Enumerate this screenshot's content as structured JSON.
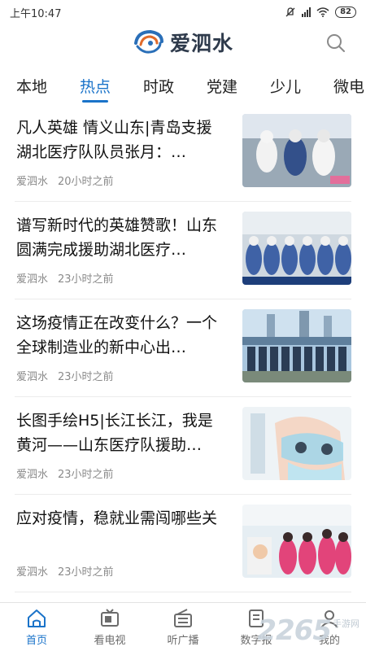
{
  "status_bar": {
    "time": "上午10:47",
    "battery": "82"
  },
  "header": {
    "app_name": "爱泗水"
  },
  "tabs": [
    {
      "label": "本地"
    },
    {
      "label": "热点"
    },
    {
      "label": "时政"
    },
    {
      "label": "党建"
    },
    {
      "label": "少儿"
    },
    {
      "label": "微电"
    }
  ],
  "active_tab": "热点",
  "news": [
    {
      "title": "凡人英雄 情义山东|青岛支援湖北医疗队队员张月：…",
      "source": "爱泗水",
      "time": "20小时之前",
      "thumb": "medical-team-photo"
    },
    {
      "title": "谱写新时代的英雄赞歌！山东圆满完成援助湖北医疗…",
      "source": "爱泗水",
      "time": "23小时之前",
      "thumb": "medics-waving-photo"
    },
    {
      "title": "这场疫情正在改变什么？一个全球制造业的新中心出…",
      "source": "爱泗水",
      "time": "23小时之前",
      "thumb": "group-outdoor-photo"
    },
    {
      "title": "长图手绘H5|长江长江，我是黄河——山东医疗队援助…",
      "source": "爱泗水",
      "time": "23小时之前",
      "thumb": "illustration-nurse-mask"
    },
    {
      "title": "应对疫情，稳就业需闯哪些关",
      "source": "爱泗水",
      "time": "23小时之前",
      "thumb": "workers-pink-uniform-photo"
    }
  ],
  "bottom_nav": [
    {
      "label": "首页",
      "icon": "home-icon"
    },
    {
      "label": "看电视",
      "icon": "tv-icon"
    },
    {
      "label": "听广播",
      "icon": "radio-icon"
    },
    {
      "label": "数字报",
      "icon": "newspaper-icon"
    },
    {
      "label": "我的",
      "icon": "profile-icon"
    }
  ],
  "watermark": {
    "text": "2265",
    "sub": "手游网"
  },
  "colors": {
    "accent": "#1a73c9",
    "title": "#111111",
    "meta": "#8a8a8a"
  }
}
